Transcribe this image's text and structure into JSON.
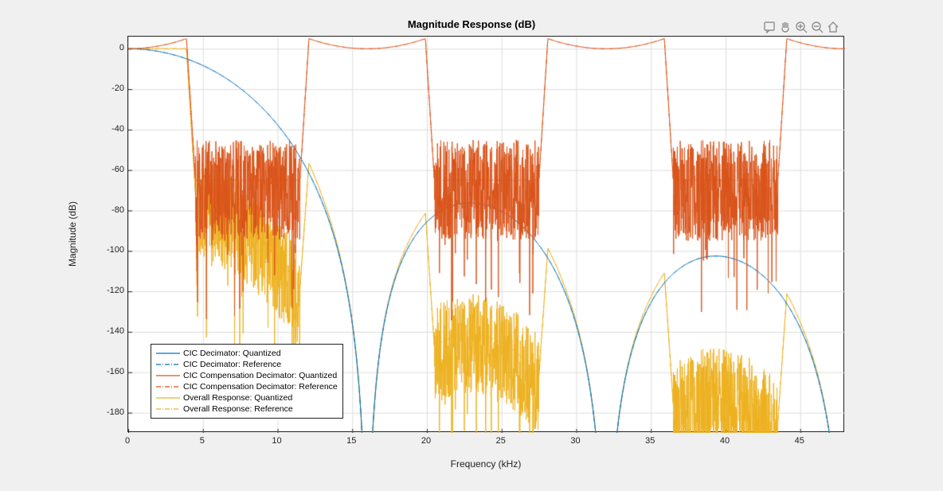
{
  "chart_data": {
    "type": "line",
    "title": "Magnitude Response (dB)",
    "xlabel": "Frequency (kHz)",
    "ylabel": "Magnitude (dB)",
    "xlim": [
      0,
      48
    ],
    "ylim": [
      -190,
      6
    ],
    "xticks": [
      0,
      5,
      10,
      15,
      20,
      25,
      30,
      35,
      40,
      45
    ],
    "yticks": [
      -180,
      -160,
      -140,
      -120,
      -100,
      -80,
      -60,
      -40,
      -20,
      0
    ],
    "series": [
      {
        "name": "CIC Decimator: Quantized",
        "color": "#0072BD",
        "style": "solid",
        "kind": "cic",
        "period_khz": 16,
        "stages": 5
      },
      {
        "name": "CIC Decimator: Reference",
        "color": "#0072BD",
        "style": "dashdot",
        "kind": "cic",
        "period_khz": 16,
        "stages": 5
      },
      {
        "name": "CIC Compensation Decimator: Quantized",
        "color": "#D95319",
        "style": "solid",
        "kind": "comp",
        "period_khz": 16,
        "passband_khz": 3.9,
        "stopband_khz": 4.5,
        "stop_db": -65,
        "ripple_db": 5
      },
      {
        "name": "CIC Compensation Decimator: Reference",
        "color": "#D95319",
        "style": "dashdot",
        "kind": "comp",
        "period_khz": 16,
        "passband_khz": 3.9,
        "stopband_khz": 4.5,
        "stop_db": -65,
        "ripple_db": 5
      },
      {
        "name": "Overall Response: Quantized",
        "color": "#EDB120",
        "style": "solid",
        "kind": "overall"
      },
      {
        "name": "Overall Response: Reference",
        "color": "#EDB120",
        "style": "dashdot",
        "kind": "overall"
      }
    ]
  },
  "legend": {
    "items": [
      "CIC Decimator: Quantized",
      "CIC Decimator: Reference",
      "CIC Compensation Decimator: Quantized",
      "CIC Compensation Decimator: Reference",
      "Overall Response: Quantized",
      "Overall Response: Reference"
    ]
  },
  "toolbar": {
    "data_tips": "Data Tips",
    "pan": "Pan",
    "zoom_in": "Zoom In",
    "zoom_out": "Zoom Out",
    "home": "Restore View"
  }
}
